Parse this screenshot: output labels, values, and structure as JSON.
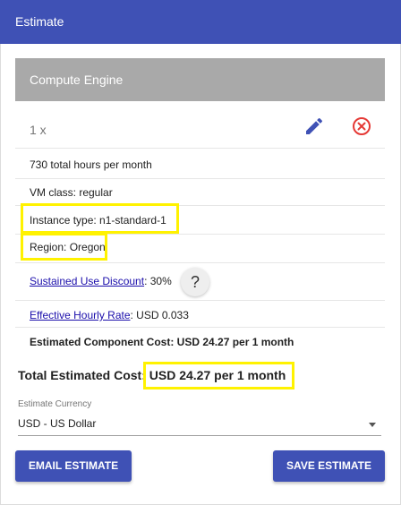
{
  "header": {
    "title": "Estimate"
  },
  "card": {
    "title": "Compute Engine",
    "quantity": "1 x",
    "icons": {
      "edit": "pencil-icon",
      "remove": "close-circle-icon"
    },
    "hours": "730 total hours per month",
    "vm_class": "VM class: regular",
    "instance_type": "Instance type: n1-standard-1",
    "region": "Region: Oregon",
    "sustained_use": {
      "link": "Sustained Use Discount",
      "value": ": 30%",
      "help": "?"
    },
    "hourly_rate": {
      "link": "Effective Hourly Rate",
      "value": ": USD 0.033"
    },
    "component_cost": "Estimated Component Cost: USD 24.27 per 1 month"
  },
  "total": {
    "label": "Total Estimated Cost: ",
    "value": "USD 24.27 per 1 month"
  },
  "currency": {
    "label": "Estimate Currency",
    "selected": "USD - US Dollar"
  },
  "buttons": {
    "email": "EMAIL ESTIMATE",
    "save": "SAVE ESTIMATE"
  },
  "colors": {
    "appbar": "#3f51b5",
    "card_header": "#a9a9a9",
    "button": "#3f51b5",
    "highlight": "#fff200",
    "remove_icon": "#e53935",
    "link": "#1a0dab"
  }
}
